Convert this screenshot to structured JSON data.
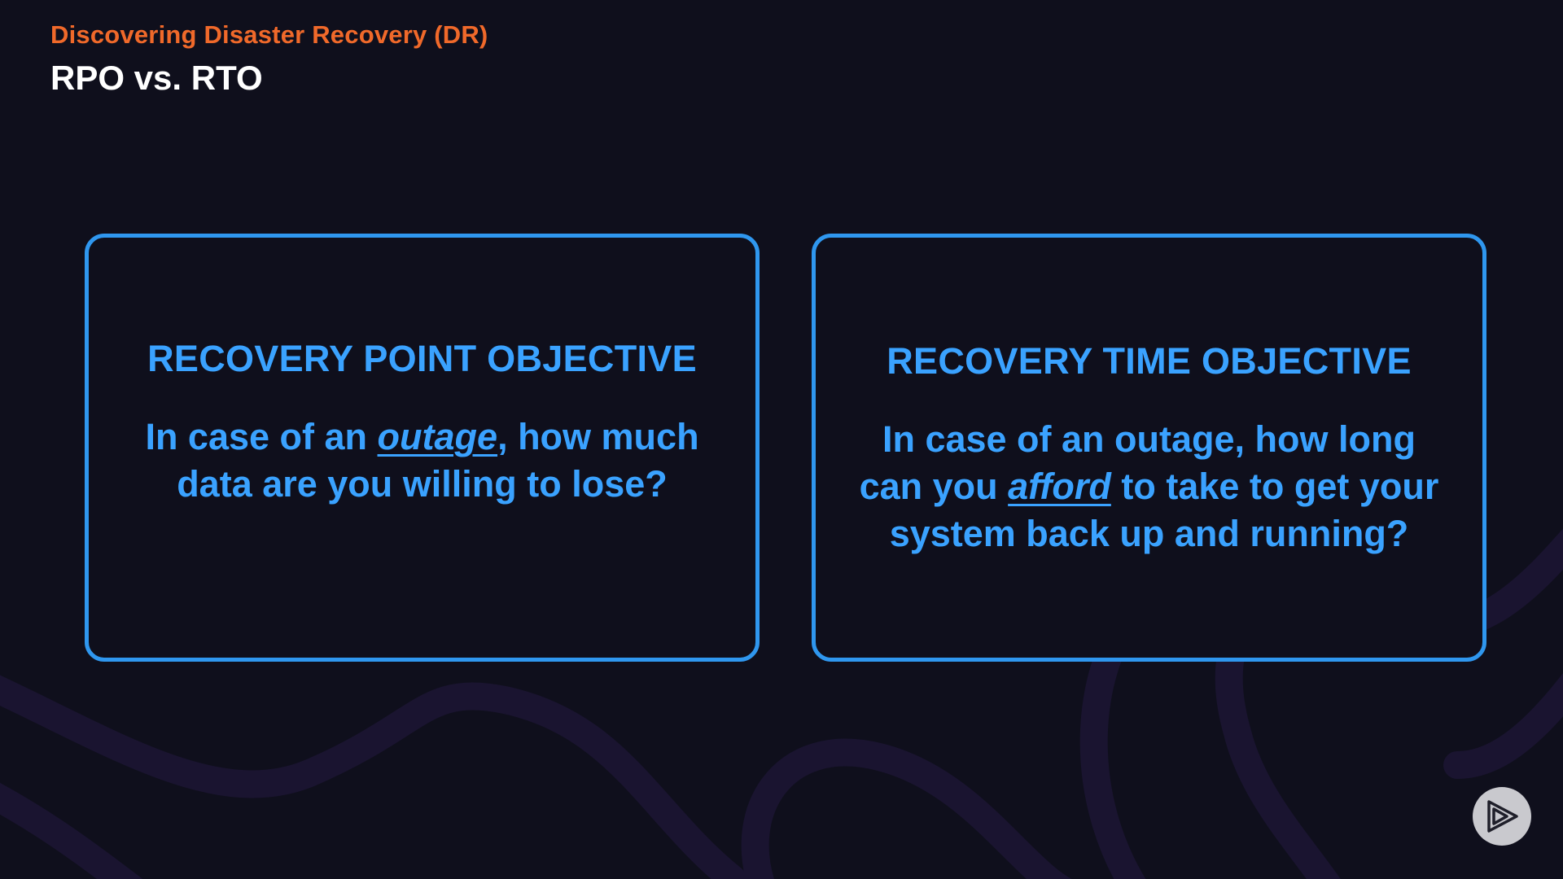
{
  "header": {
    "course_title": "Discovering Disaster Recovery (DR)",
    "slide_title": "RPO vs. RTO"
  },
  "cards": [
    {
      "heading": "RECOVERY POINT OBJECTIVE",
      "line1_pre": "In case of an ",
      "line1_emph": "outage",
      "line1_post": ", how much",
      "line2": "data are you willing to lose?"
    },
    {
      "heading": "RECOVERY TIME OBJECTIVE",
      "line1": "In case of an outage, how long",
      "line2_pre": "can you ",
      "line2_emph": "afford",
      "line2_post": " to take to get your",
      "line3": "system back up and running?"
    }
  ],
  "colors": {
    "background": "#0f0f1c",
    "accent_orange": "#f0692a",
    "accent_blue": "#2f97ef",
    "swirl": "#1a1430",
    "logo": "#c9c9ce"
  },
  "icons": {
    "brand_logo": "play-triangle-icon"
  }
}
